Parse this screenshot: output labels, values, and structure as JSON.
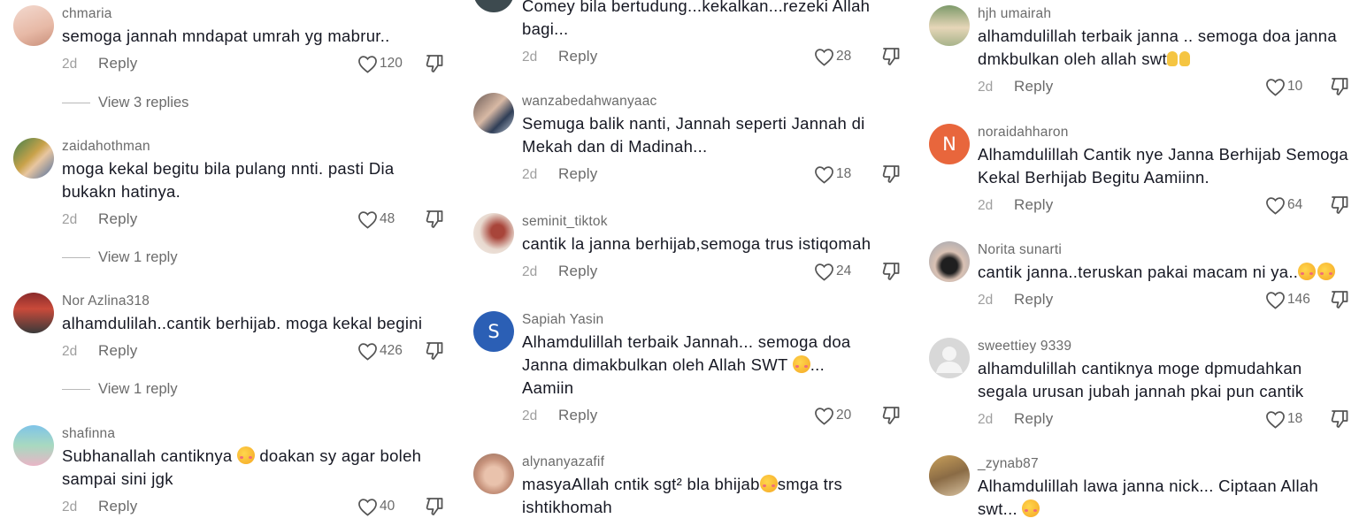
{
  "colors": {
    "username": "#6b6b6b",
    "text": "#161823",
    "meta": "#9e9e9e",
    "accent_orange": "#e8663c",
    "accent_blue": "#2b5fb5"
  },
  "icons": {
    "like": "heart-outline-icon",
    "dislike": "thumb-down-outline-icon",
    "emoji_blush": "smiling-face-with-hearts-emoji",
    "emoji_hands": "raised-hands-emoji"
  },
  "reply_label": "Reply",
  "columns": [
    {
      "comments": [
        {
          "username": "chmaria",
          "text": "semoga jannah mndapat umrah yg mabrur..",
          "time": "2d",
          "likes": "120",
          "view_replies": "View 3 replies"
        },
        {
          "username": "zaidahothman",
          "text": "moga kekal begitu bila pulang nnti. pasti Dia bukakn hatinya.",
          "time": "2d",
          "likes": "48",
          "view_replies": "View 1 reply"
        },
        {
          "username": "Nor Azlina318",
          "text": "alhamdulilah..cantik berhijab. moga kekal begini",
          "time": "2d",
          "likes": "426",
          "view_replies": "View 1 reply"
        },
        {
          "username": "shafinna",
          "text_before": "Subhanallah cantiknya ",
          "text_after": " doakan sy agar boleh sampai sini jgk",
          "time": "2d",
          "likes": "40"
        }
      ]
    },
    {
      "comments": [
        {
          "text": "Comey bila bertudung...kekalkan...rezeki Allah bagi...",
          "time": "2d",
          "likes": "28"
        },
        {
          "username": "wanzabedahwanyaac",
          "text": "Semuga balik nanti, Jannah seperti Jannah di Mekah dan di Madinah...",
          "time": "2d",
          "likes": "18"
        },
        {
          "username": "seminit_tiktok",
          "text": "cantik la janna berhijab,semoga trus istiqomah",
          "time": "2d",
          "likes": "24"
        },
        {
          "username": "Sapiah Yasin",
          "avatar_letter": "S",
          "text_before": "Alhamdulillah terbaik Jannah... semoga doa Janna dimakbulkan oleh Allah SWT ",
          "text_after": "... Aamiin",
          "time": "2d",
          "likes": "20"
        },
        {
          "username": "alynanyazafif",
          "text_before": "masyaAllah cntik sgt² bla bhijab",
          "text_after": "smga trs ishtikhomah"
        }
      ]
    },
    {
      "comments": [
        {
          "username": "hjh umairah",
          "text_before": "alhamdulillah terbaik janna .. semoga doa janna dmkbulkan oleh allah swt",
          "time": "2d",
          "likes": "10"
        },
        {
          "username": "noraidahharon",
          "avatar_letter": "N",
          "text": "Alhamdulillah Cantik nye Janna Berhijab Semoga Kekal Berhijab Begitu Aamiinn.",
          "time": "2d",
          "likes": "64"
        },
        {
          "username": "Norita sunarti",
          "text_before": "cantik janna..teruskan pakai macam ni ya..",
          "time": "2d",
          "likes": "146"
        },
        {
          "username": "sweettiey 9339",
          "text": "alhamdulillah cantiknya moge dpmudahkan segala urusan jubah jannah pkai pun cantik",
          "time": "2d",
          "likes": "18"
        },
        {
          "username": "_zynab87",
          "text_before": "Alhamdulillah lawa janna nick... Ciptaan Allah swt... "
        }
      ]
    }
  ]
}
